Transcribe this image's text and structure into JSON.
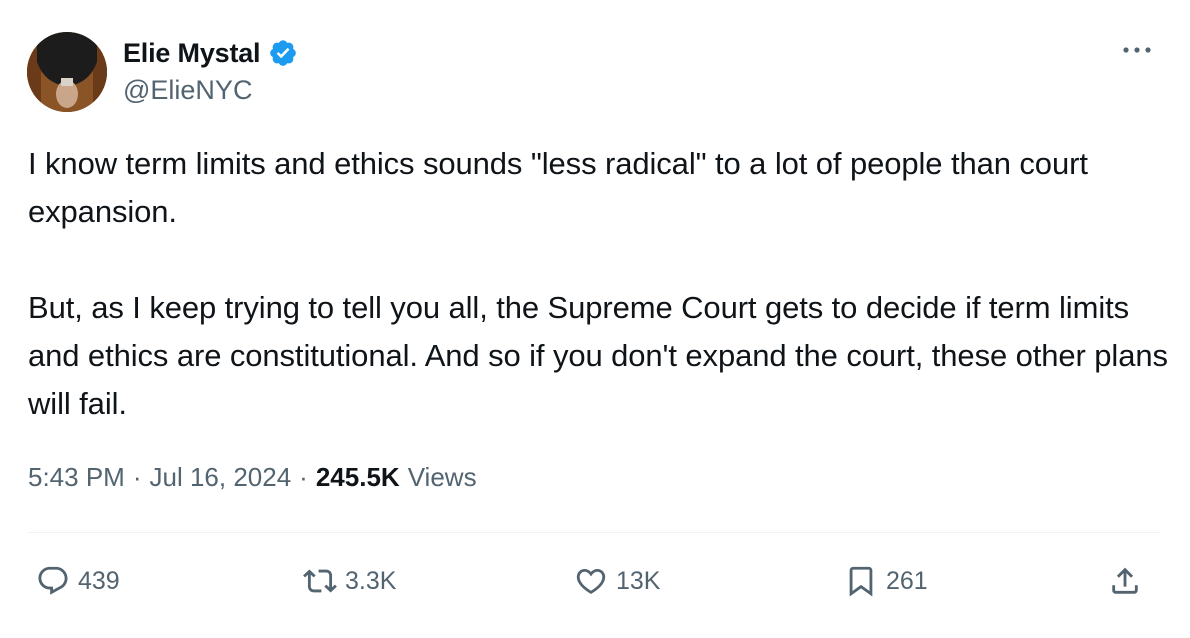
{
  "author": {
    "display_name": "Elie Mystal",
    "handle": "@ElieNYC"
  },
  "tweet": {
    "paragraphs": [
      "I know term limits and ethics sounds \"less radical\" to a lot of people than court expansion.",
      "But, as I keep trying to tell you all, the Supreme Court gets to decide if term limits and ethics are constitutional. And so if you don't expand the court, these other plans will fail."
    ],
    "time": "5:43 PM",
    "date": "Jul 16, 2024",
    "separator": "·",
    "views_count": "245.5K",
    "views_label": "Views"
  },
  "actions": {
    "replies": "439",
    "reposts": "3.3K",
    "likes": "13K",
    "bookmarks": "261"
  },
  "icons": {
    "verified": "verified-badge-icon",
    "more": "more-dots-icon",
    "reply": "reply-icon",
    "repost": "repost-icon",
    "like": "heart-icon",
    "bookmark": "bookmark-icon",
    "share": "share-icon"
  },
  "colors": {
    "verified_blue": "#1d9bf0",
    "text_primary": "#0f1419",
    "text_secondary": "#536471",
    "divider": "#eff3f4"
  }
}
